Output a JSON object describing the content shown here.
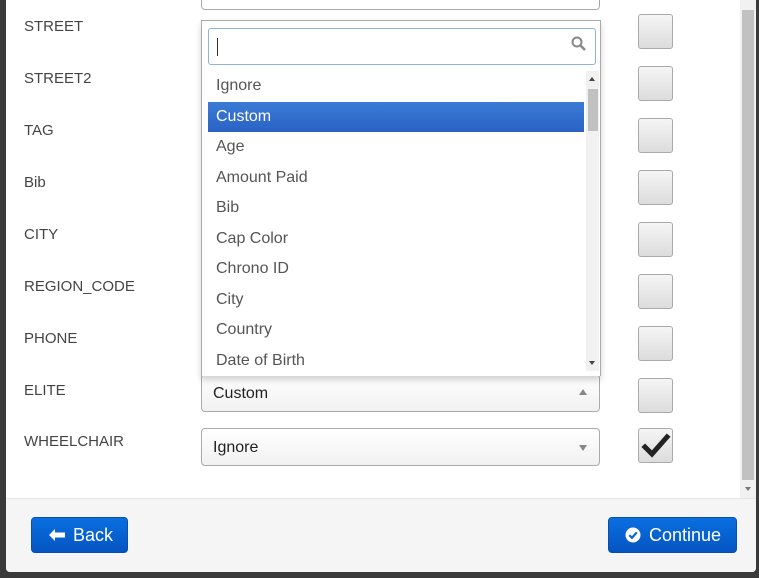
{
  "fields": [
    {
      "label": "STREET",
      "checked": false
    },
    {
      "label": "STREET2",
      "checked": false
    },
    {
      "label": "TAG",
      "checked": false
    },
    {
      "label": "Bib",
      "checked": false
    },
    {
      "label": "CITY",
      "checked": false
    },
    {
      "label": "REGION_CODE",
      "checked": false
    },
    {
      "label": "PHONE",
      "checked": false
    },
    {
      "label": "ELITE",
      "value": "Custom",
      "checked": false,
      "open": true
    },
    {
      "label": "WHEELCHAIR",
      "value": "Ignore",
      "checked": true
    }
  ],
  "dropdown": {
    "search_value": "",
    "options": [
      "Ignore",
      "Custom",
      "Age",
      "Amount Paid",
      "Bib",
      "Cap Color",
      "Chrono ID",
      "City",
      "Country",
      "Date of Birth"
    ],
    "highlighted": "Custom"
  },
  "footer": {
    "back_label": "Back",
    "continue_label": "Continue"
  },
  "colors": {
    "button": "#0a63d4",
    "highlight": "#3875d7"
  }
}
